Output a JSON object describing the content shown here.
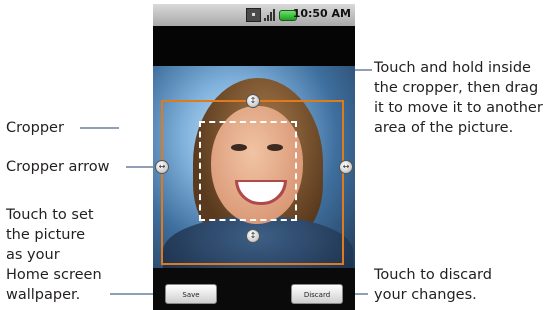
{
  "callouts": {
    "cropper": "Cropper",
    "cropper_arrow": "Cropper arrow",
    "set_wallpaper": [
      "Touch to set",
      "the picture",
      "as your",
      "Home screen",
      "wallpaper."
    ],
    "move_cropper": [
      "Touch and hold inside",
      "the cropper, then drag",
      "it to move it to another",
      "area of the picture."
    ],
    "discard": [
      "Touch to discard",
      "your changes."
    ]
  },
  "phone": {
    "status_time": "10:50 AM",
    "save_label": "Save",
    "discard_label": "Discard"
  },
  "colors": {
    "cropper_outline": "#e07a1a",
    "leader_line": "#1f3f6e"
  }
}
